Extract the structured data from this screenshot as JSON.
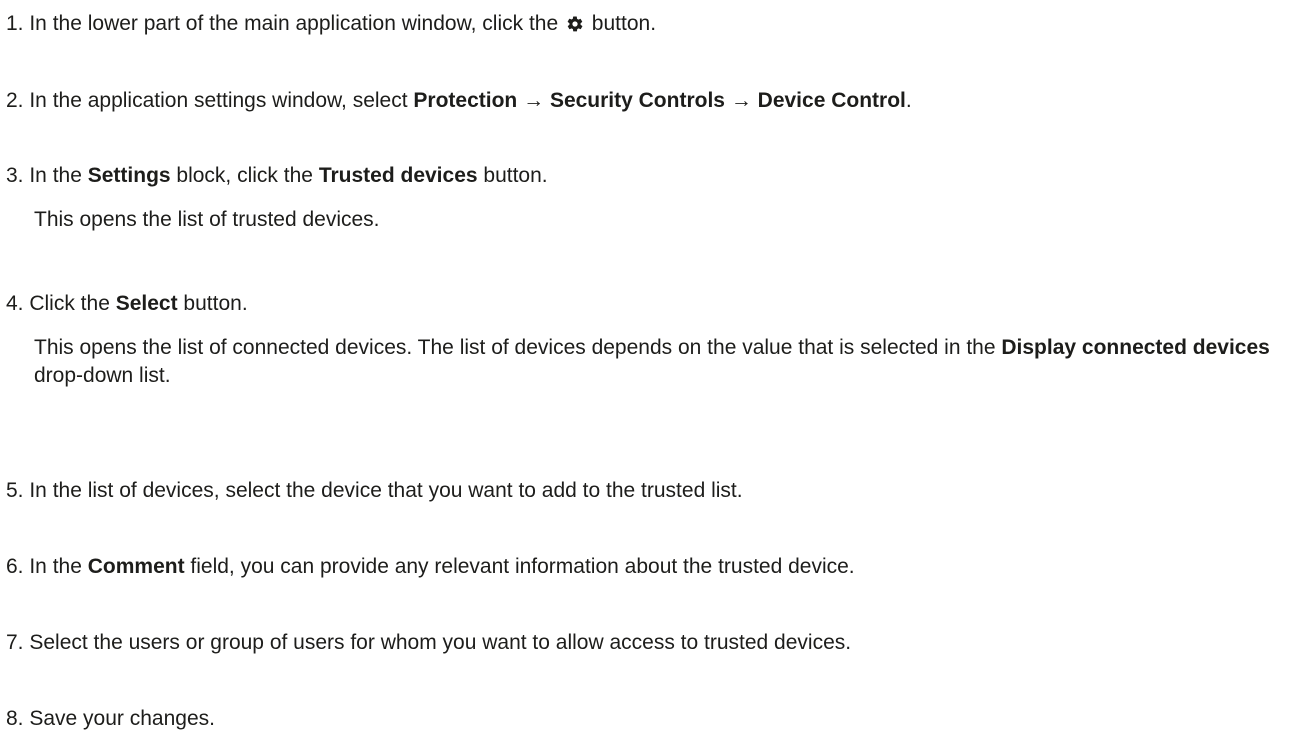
{
  "steps": [
    {
      "number": "1.",
      "before": " In the lower part of the main application window, click the ",
      "icon": "gear-icon",
      "after": " button."
    },
    {
      "number": "2.",
      "before": " In the application settings window, select ",
      "bold1": "Protection",
      "arrow1": " → ",
      "bold2": "Security Controls",
      "arrow2": " → ",
      "bold3": "Device Control",
      "after": "."
    },
    {
      "number": "3.",
      "before": " In the ",
      "bold1": "Settings",
      "middle": " block, click the ",
      "bold2": "Trusted devices",
      "after": " button.",
      "sub": "This opens the list of trusted devices."
    },
    {
      "number": "4.",
      "before": " Click the ",
      "bold1": "Select",
      "after": " button.",
      "sub_before": "This opens the list of connected devices. The list of devices depends on the value that is selected in the ",
      "sub_bold": "Display connected devices",
      "sub_after": " drop-down list."
    },
    {
      "number": "5.",
      "text": " In the list of devices, select the device that you want to add to the trusted list."
    },
    {
      "number": "6.",
      "before": " In the ",
      "bold1": "Comment",
      "after": " field, you can provide any relevant information about the trusted device."
    },
    {
      "number": "7.",
      "text": " Select the users or group of users for whom you want to allow access to trusted devices."
    },
    {
      "number": "8.",
      "text": " Save your changes."
    }
  ]
}
